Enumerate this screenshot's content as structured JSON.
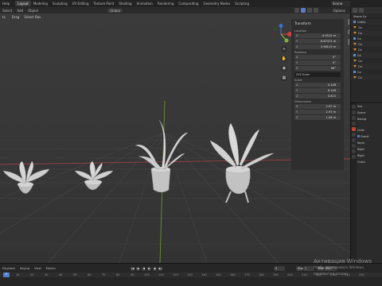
{
  "topbar": {
    "menus": [
      "Help"
    ],
    "workspaces": [
      "Layout",
      "Modeling",
      "Sculpting",
      "UV Editing",
      "Texture Paint",
      "Shading",
      "Animation",
      "Rendering",
      "Compositing",
      "Geometry Nodes",
      "Scripting"
    ],
    "active_workspace": "Layout",
    "scene_name": "Scene"
  },
  "toolbar": {
    "items": [
      "Select",
      "Add",
      "Object"
    ],
    "orientation": "Global",
    "options_label": "Options"
  },
  "tool_header": {
    "items": [
      "Drag",
      "Select Box"
    ],
    "left_label": "ts"
  },
  "n_panel": {
    "header": "Transform",
    "location_label": "Location",
    "location": [
      {
        "axis": "X",
        "value": "-9.4515 m"
      },
      {
        "axis": "Y",
        "value": "-9.67471 m"
      },
      {
        "axis": "Z",
        "value": "3.96113 m"
      }
    ],
    "rotation_label": "Rotation",
    "rotation": [
      {
        "axis": "X",
        "value": "0°"
      },
      {
        "axis": "Y",
        "value": "0°"
      },
      {
        "axis": "Z",
        "value": "90°"
      }
    ],
    "rotation_mode": "XYZ Euler",
    "scale_label": "Scale",
    "scale": [
      {
        "axis": "X",
        "value": "0.148"
      },
      {
        "axis": "Y",
        "value": "0.148"
      },
      {
        "axis": "Z",
        "value": "0.815"
      }
    ],
    "dimensions_label": "Dimensions",
    "dimensions": [
      {
        "axis": "X",
        "value": "2.97 m"
      },
      {
        "axis": "Y",
        "value": "2.97 m"
      },
      {
        "axis": "Z",
        "value": "1.06 m"
      }
    ],
    "side_tabs": [
      "Item",
      "Tool",
      "View"
    ]
  },
  "outliner": {
    "rows": [
      "Scene Co",
      "Collec",
      "Ca",
      "Ca",
      "Co",
      "Ca",
      "Ca",
      "Co",
      "Ca",
      "Ca",
      "Co",
      "Ca"
    ]
  },
  "properties": {
    "lines": [
      "Sce",
      "Scene",
      "Backgr",
      "Units",
      "Gravit",
      "Keyin",
      "Rigid",
      "Rigid",
      "Custo"
    ]
  },
  "timeline": {
    "labels": [
      "Playback",
      "Keying",
      "View",
      "Marker"
    ],
    "current_frame": "0",
    "start_label": "Start",
    "start_value": "1",
    "end_label": "End",
    "end_value": "250",
    "ruler_numbers": [
      "10",
      "20",
      "30",
      "40",
      "50",
      "60",
      "70",
      "80",
      "90",
      "100",
      "110",
      "120",
      "130",
      "140",
      "150",
      "160",
      "170",
      "180",
      "190",
      "200",
      "210",
      "220",
      "230",
      "240",
      "250"
    ]
  },
  "watermark": {
    "title": "Активация Windows",
    "subtitle": "Чтобы активировать Windows, перейдите в раздел"
  },
  "colors": {
    "accent_blue": "#4f7fd0",
    "active_orange": "#e08a30",
    "axis_x": "#c8403a",
    "axis_y": "#7fb03a",
    "axis_z": "#3d6fc8"
  }
}
